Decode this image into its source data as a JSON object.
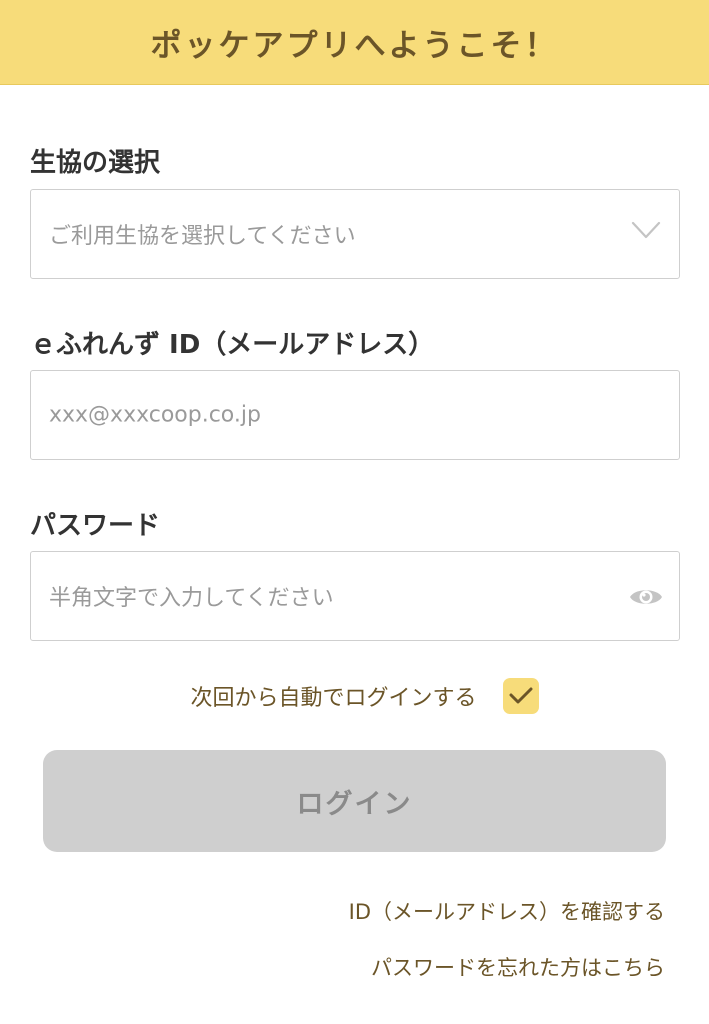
{
  "header": {
    "title": "ポッケアプリへようこそ！"
  },
  "coop_select": {
    "label": "生協の選択",
    "placeholder": "ご利用生協を選択してください",
    "icon": "chevron-down-icon"
  },
  "email": {
    "label": "ｅふれんず ID（メールアドレス）",
    "placeholder": "xxx@xxxcoop.co.jp"
  },
  "password": {
    "label": "パスワード",
    "placeholder": "半角文字で入力してください",
    "icon": "eye-icon"
  },
  "auto_login": {
    "label": "次回から自動でログインする",
    "checked": true
  },
  "login_button": {
    "label": "ログイン"
  },
  "links": {
    "confirm_id": "ID（メールアドレス）を確認する",
    "forgot_password": "パスワードを忘れた方はこちら"
  },
  "colors": {
    "accent": "#f7dc7a",
    "brand_text": "#6b5528",
    "disabled_button": "#cfcfcf"
  }
}
